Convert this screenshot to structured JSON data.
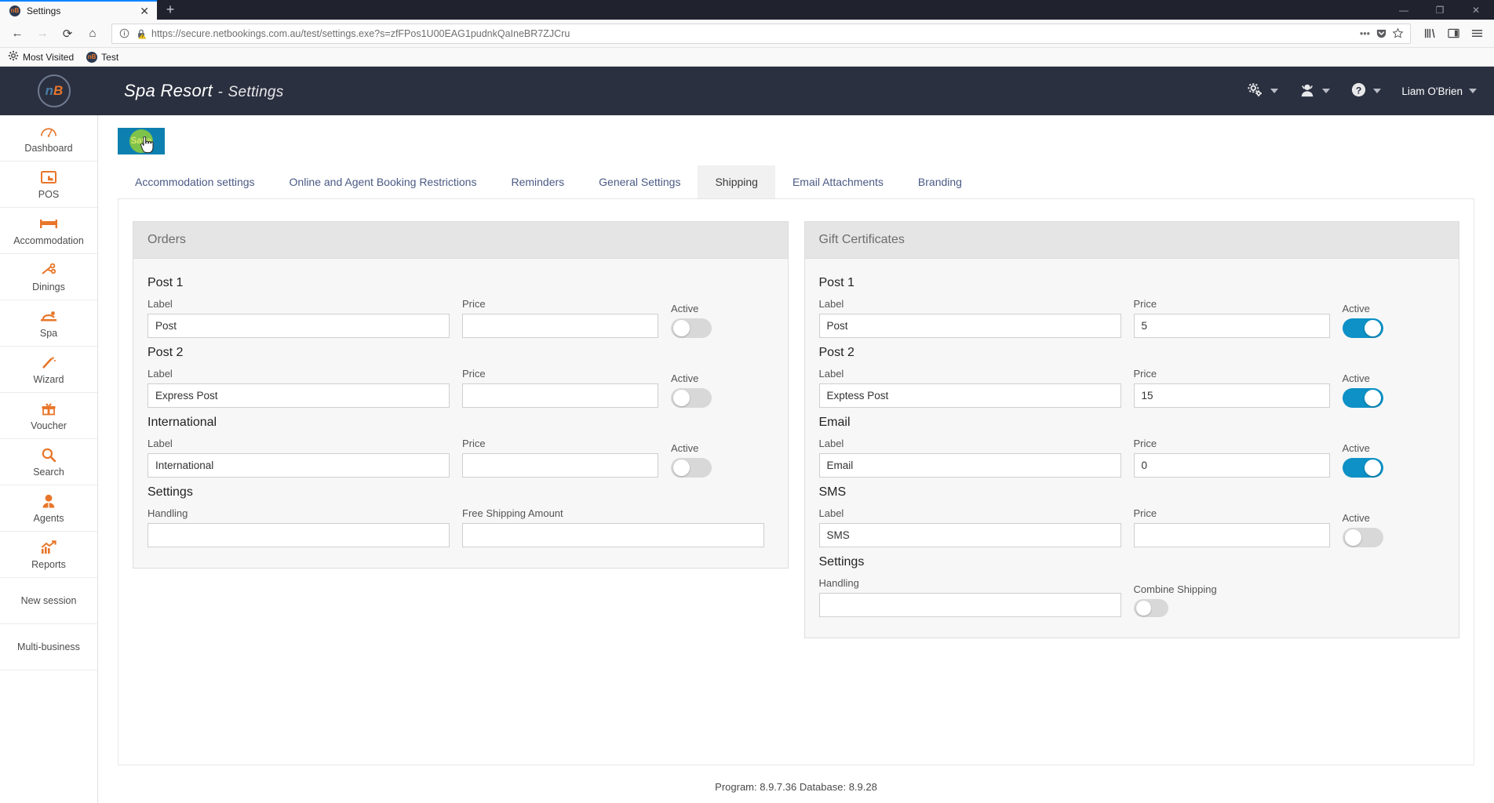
{
  "browser": {
    "tab_title": "Settings",
    "favicon_text": "nB",
    "close_tab": "✕",
    "new_tab": "+",
    "window_minimize": "—",
    "window_restore": "❐",
    "window_close": "✕",
    "nav": {
      "back": "←",
      "forward": "→",
      "reload": "⟳",
      "home": "⌂"
    },
    "url": "https://secure.netbookings.com.au/test/settings.exe?s=zfFPos1U00EAG1pudnkQaIneBR7ZJCru",
    "url_domain": "secure.netbookings.com.au",
    "url_prefix": "https://",
    "url_suffix": "/test/settings.exe?s=zfFPos1U00EAG1pudnkQaIneBR7ZJCru",
    "page_actions": "•••",
    "bookmarks": [
      {
        "label": "Most Visited",
        "icon": "gear-icon"
      },
      {
        "label": "Test",
        "icon": "nb-favicon"
      }
    ]
  },
  "header": {
    "logo_text": "nB",
    "business_name": "Spa Resort",
    "separator": "-",
    "page_name": "Settings",
    "menus": [
      {
        "name": "settings-menu",
        "icon": "gears-icon"
      },
      {
        "name": "user-menu",
        "icon": "agent-icon"
      },
      {
        "name": "help-menu",
        "icon": "question-icon"
      }
    ],
    "user_name": "Liam O'Brien"
  },
  "sidebar": {
    "items": [
      {
        "label": "Dashboard",
        "icon": "gauge-icon"
      },
      {
        "label": "POS",
        "icon": "pos-icon"
      },
      {
        "label": "Accommodation",
        "icon": "bed-icon"
      },
      {
        "label": "Dinings",
        "icon": "cutlery-icon"
      },
      {
        "label": "Spa",
        "icon": "massage-icon"
      },
      {
        "label": "Wizard",
        "icon": "wand-icon"
      },
      {
        "label": "Voucher",
        "icon": "gift-icon"
      },
      {
        "label": "Search",
        "icon": "magnifier-icon"
      },
      {
        "label": "Agents",
        "icon": "agent-icon"
      },
      {
        "label": "Reports",
        "icon": "chart-icon"
      },
      {
        "label": "New session",
        "icon": ""
      },
      {
        "label": "Multi-business",
        "icon": ""
      }
    ]
  },
  "toolbar": {
    "save_label": "Save"
  },
  "tabs": [
    {
      "label": "Accommodation settings",
      "active": false
    },
    {
      "label": "Online and Agent Booking Restrictions",
      "active": false
    },
    {
      "label": "Reminders",
      "active": false
    },
    {
      "label": "General Settings",
      "active": false
    },
    {
      "label": "Shipping",
      "active": true
    },
    {
      "label": "Email Attachments",
      "active": false
    },
    {
      "label": "Branding",
      "active": false
    }
  ],
  "orders_panel": {
    "title": "Orders",
    "groups": [
      {
        "title": "Post 1",
        "label_caption": "Label",
        "label_value": "Post",
        "price_caption": "Price",
        "price_value": "",
        "active_caption": "Active",
        "active": false
      },
      {
        "title": "Post 2",
        "label_caption": "Label",
        "label_value": "Express Post",
        "price_caption": "Price",
        "price_value": "",
        "active_caption": "Active",
        "active": false
      },
      {
        "title": "International",
        "label_caption": "Label",
        "label_value": "International",
        "price_caption": "Price",
        "price_value": "",
        "active_caption": "Active",
        "active": false
      }
    ],
    "settings": {
      "title": "Settings",
      "handling_caption": "Handling",
      "handling_value": "",
      "free_shipping_caption": "Free Shipping Amount",
      "free_shipping_value": ""
    }
  },
  "gift_panel": {
    "title": "Gift Certificates",
    "groups": [
      {
        "title": "Post 1",
        "label_caption": "Label",
        "label_value": "Post",
        "price_caption": "Price",
        "price_value": "5",
        "active_caption": "Active",
        "active": true
      },
      {
        "title": "Post 2",
        "label_caption": "Label",
        "label_value": "Exptess Post",
        "price_caption": "Price",
        "price_value": "15",
        "active_caption": "Active",
        "active": true
      },
      {
        "title": "Email",
        "label_caption": "Label",
        "label_value": "Email",
        "price_caption": "Price",
        "price_value": "0",
        "active_caption": "Active",
        "active": true
      },
      {
        "title": "SMS",
        "label_caption": "Label",
        "label_value": "SMS",
        "price_caption": "Price",
        "price_value": "",
        "active_caption": "Active",
        "active": false
      }
    ],
    "settings": {
      "title": "Settings",
      "handling_caption": "Handling",
      "handling_value": "",
      "combine_caption": "Combine Shipping",
      "combine_active": false
    }
  },
  "footer": {
    "version_text": "Program: 8.9.7.36 Database: 8.9.28"
  },
  "colors": {
    "accent_orange": "#e8762a",
    "header_dark": "#2b3040",
    "toggle_on": "#0d91c6",
    "save_teal": "#0d80b0",
    "save_green": "#7dc24b"
  }
}
